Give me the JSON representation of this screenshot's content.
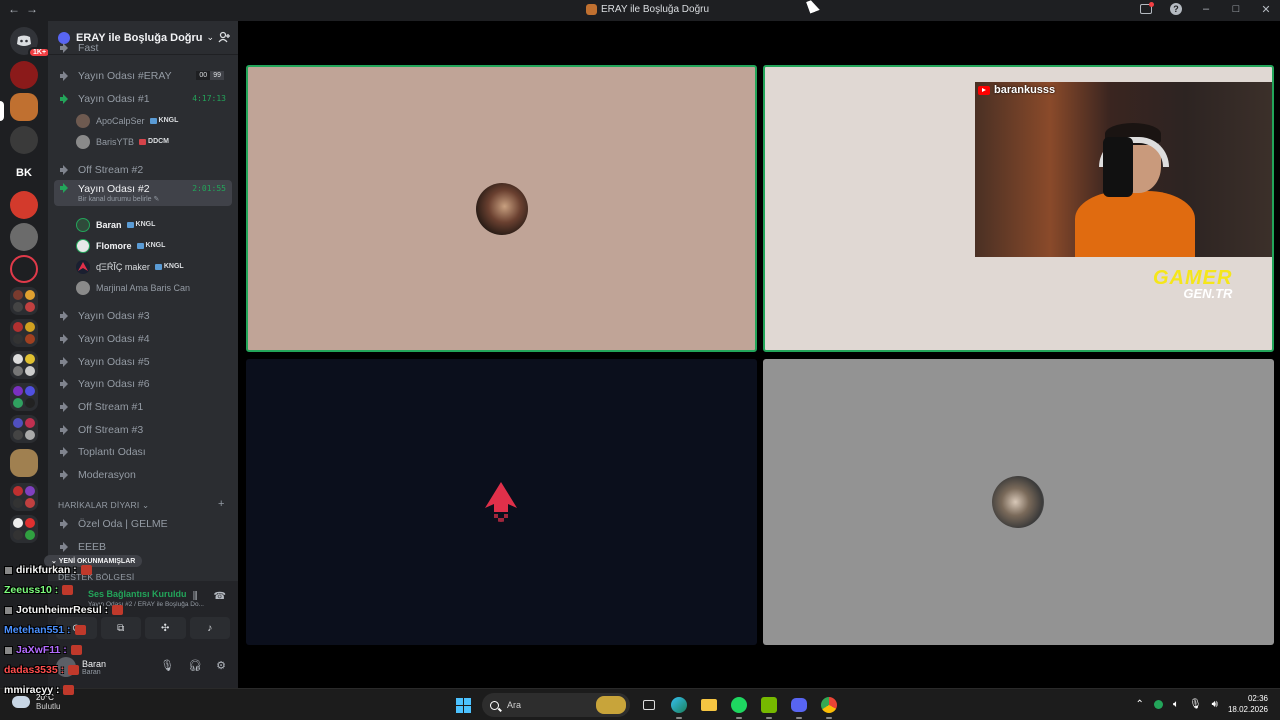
{
  "window": {
    "title": "ERAY ile Boşluğa Doğru",
    "back": "←",
    "forward": "→"
  },
  "server_rail": {
    "home_badge": "1K+",
    "text_server_label": "BK"
  },
  "guild": {
    "name": "ERAY ile Boşluğa Doğru"
  },
  "channels": [
    {
      "name": "Yayın Odası #ERAY",
      "limit_a": "00",
      "limit_b": "99"
    },
    {
      "name": "Yayın Odası #1",
      "timer": "4:17:13"
    },
    {
      "name": "Off Stream #2"
    },
    {
      "name": "Yayın Odası #2",
      "timer": "2:01:55",
      "status": "Bir kanal durumu belirle"
    },
    {
      "name": "Yayın Odası #3"
    },
    {
      "name": "Yayın Odası #4"
    },
    {
      "name": "Yayın Odası #5"
    },
    {
      "name": "Yayın Odası #6"
    },
    {
      "name": "Off Stream #1"
    },
    {
      "name": "Off Stream #3"
    },
    {
      "name": "Toplantı Odası"
    },
    {
      "name": "Moderasyon"
    },
    {
      "name": "Özel Oda | GELME"
    },
    {
      "name": "EEEB"
    }
  ],
  "top_partial": "Fast",
  "room1_users": [
    {
      "name": "ApoCalpSer",
      "tag": "KNGL"
    },
    {
      "name": "BarisYTB",
      "tag": "DDCM"
    }
  ],
  "room2_users": [
    {
      "name": "Baran",
      "tag": "KNGL"
    },
    {
      "name": "Flomore",
      "tag": "KNGL"
    },
    {
      "name": "ʠΞŔĨÇ maker",
      "tag": "KNGL"
    },
    {
      "name": "Marjinal Ama Baris Can",
      "tag": ""
    }
  ],
  "categories": {
    "harikalar": "HARİKALAR DİYARI",
    "destek": "DESTEK BÖLGESİ"
  },
  "new_unread": "YENİ OKUNMAMIŞLAR",
  "voice_panel": {
    "status": "Ses Bağlantısı Kuruldu",
    "sub": "Yayın Odası #2 / ERAY ile Boşluğa Do...",
    "username": "Baran",
    "user_sub": "Baran"
  },
  "chat_overlay": [
    {
      "user": "dirikfurkan :",
      "color": "#f5f5f5"
    },
    {
      "user": "Zeeuss10 :",
      "color": "#7cfc7c"
    },
    {
      "user": "JotunheimrResul :",
      "color": "#f5f5f5"
    },
    {
      "user": "Metehan551 :",
      "color": "#4a90ff"
    },
    {
      "user": "JaXwF11 :",
      "color": "#b46cff"
    },
    {
      "user": "dadas3535 :",
      "color": "#ff4d4d"
    },
    {
      "user": "mmiracyy :",
      "color": "#f5f5f5"
    }
  ],
  "stream": {
    "handle": "barankusss",
    "watermark_main": "GAMER",
    "watermark_sub": "GEN.TR"
  },
  "taskbar": {
    "temperature": "20°C",
    "weather": "Bulutlu",
    "search_placeholder": "Ara",
    "time": "02:36",
    "date": "18.02.2026"
  },
  "colors": {
    "speaking": "#23a55a",
    "tile1_bg": "#c0a497",
    "tile2_bg": "#e0d8d3",
    "tile3_bg": "#0b0f1c",
    "tile4_bg": "#939393"
  }
}
